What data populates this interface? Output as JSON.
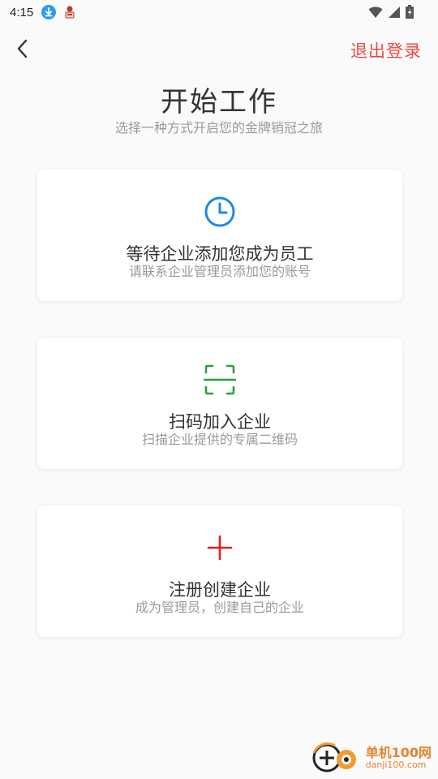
{
  "status_bar": {
    "time": "4:15"
  },
  "header": {
    "logout_label": "退出登录"
  },
  "title": "开始工作",
  "subtitle": "选择一种方式开启您的金牌销冠之旅",
  "cards": [
    {
      "title": "等待企业添加您成为员工",
      "description": "请联系企业管理员添加您的账号",
      "icon": "clock-icon",
      "icon_color": "#1e88e5"
    },
    {
      "title": "扫码加入企业",
      "description": "扫描企业提供的专属二维码",
      "icon": "scan-icon",
      "icon_color": "#2e9e3e"
    },
    {
      "title": "注册创建企业",
      "description": "成为管理员，创建自己的企业",
      "icon": "plus-icon",
      "icon_color": "#e02020"
    }
  ],
  "colors": {
    "accent_red": "#e84b46",
    "text_primary": "#333333",
    "text_secondary": "#9a9a9a",
    "background": "#fafafa"
  },
  "watermark": {
    "cn": "单机100网",
    "en": "danji100.com"
  }
}
